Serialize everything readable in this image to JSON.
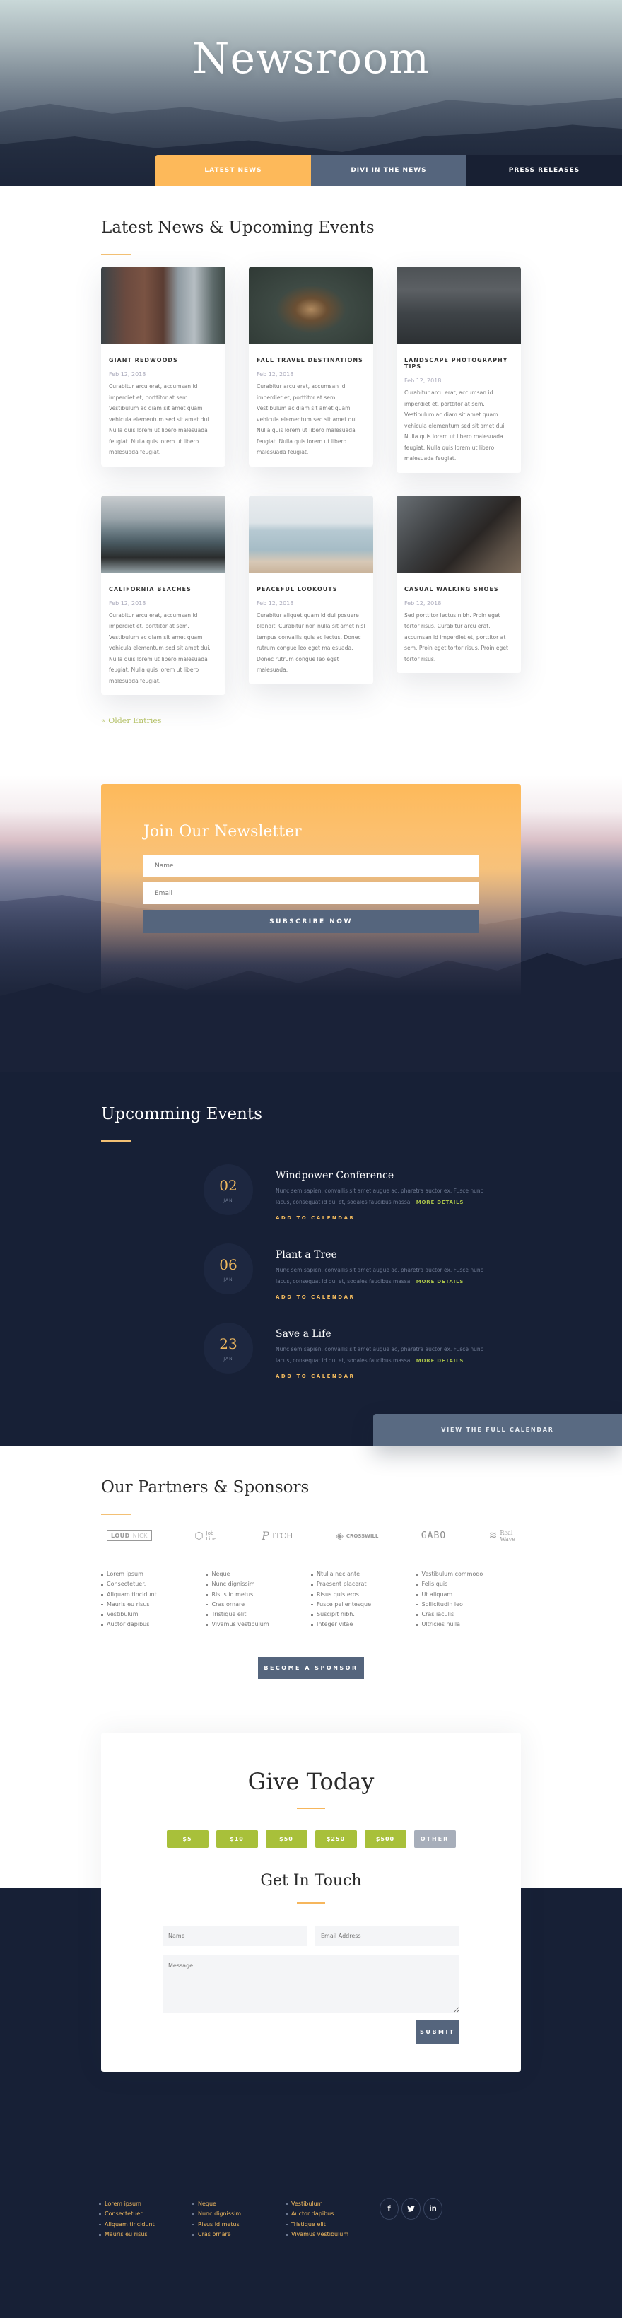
{
  "hero": {
    "title": "Newsroom",
    "tabs": [
      {
        "label": "LATEST NEWS",
        "active": true
      },
      {
        "label": "DIVI IN THE NEWS",
        "active": false
      },
      {
        "label": "PRESS RELEASES",
        "active": false
      }
    ]
  },
  "news": {
    "heading": "Latest News & Upcoming Events",
    "posts": [
      {
        "title": "GIANT REDWOODS",
        "date": "Feb 12, 2018",
        "excerpt": "Curabitur arcu erat, accumsan id imperdiet et, porttitor at sem. Vestibulum ac diam sit amet quam vehicula elementum sed sit amet dui. Nulla quis lorem ut libero malesuada feugiat. Nulla quis lorem ut libero malesuada feugiat."
      },
      {
        "title": "FALL TRAVEL DESTINATIONS",
        "date": "Feb 12, 2018",
        "excerpt": "Curabitur arcu erat, accumsan id imperdiet et, porttitor at sem. Vestibulum ac diam sit amet quam vehicula elementum sed sit amet dui. Nulla quis lorem ut libero malesuada feugiat. Nulla quis lorem ut libero malesuada feugiat."
      },
      {
        "title": "LANDSCAPE PHOTOGRAPHY TIPS",
        "date": "Feb 12, 2018",
        "excerpt": "Curabitur arcu erat, accumsan id imperdiet et, porttitor at sem. Vestibulum ac diam sit amet quam vehicula elementum sed sit amet dui. Nulla quis lorem ut libero malesuada feugiat. Nulla quis lorem ut libero malesuada feugiat."
      },
      {
        "title": "CALIFORNIA BEACHES",
        "date": "Feb 12, 2018",
        "excerpt": "Curabitur arcu erat, accumsan id imperdiet et, porttitor at sem. Vestibulum ac diam sit amet quam vehicula elementum sed sit amet dui. Nulla quis lorem ut libero malesuada feugiat. Nulla quis lorem ut libero malesuada feugiat."
      },
      {
        "title": "PEACEFUL LOOKOUTS",
        "date": "Feb 12, 2018",
        "excerpt": "Curabitur aliquet quam id dui posuere blandit. Curabitur non nulla sit amet nisl tempus convallis quis ac lectus. Donec rutrum congue leo eget malesuada. Donec rutrum congue leo eget malesuada."
      },
      {
        "title": "CASUAL WALKING SHOES",
        "date": "Feb 12, 2018",
        "excerpt": "Sed porttitor lectus nibh. Proin eget tortor risus. Curabitur arcu erat, accumsan id imperdiet et, porttitor at sem. Proin eget tortor risus. Proin eget tortor risus."
      }
    ],
    "older_entries": "« Older Entries"
  },
  "newsletter": {
    "heading": "Join Our Newsletter",
    "name_placeholder": "Name",
    "email_placeholder": "Email",
    "button": "SUBSCRIBE NOW"
  },
  "events": {
    "heading": "Upcomming Events",
    "items": [
      {
        "day": "02",
        "month": "JAN",
        "title": "Windpower Conference",
        "desc": "Nunc sem sapien, convallis sit amet augue ac, pharetra auctor ex. Fusce nunc lacus, consequat id dui et, sodales faucibus massa.",
        "more": "MORE DETAILS",
        "cal": "ADD TO CALENDAR"
      },
      {
        "day": "06",
        "month": "JAN",
        "title": "Plant a Tree",
        "desc": "Nunc sem sapien, convallis sit amet augue ac, pharetra auctor ex. Fusce nunc lacus, consequat id dui et, sodales faucibus massa.",
        "more": "MORE DETAILS",
        "cal": "ADD TO CALENDAR"
      },
      {
        "day": "23",
        "month": "JAN",
        "title": "Save a Life",
        "desc": "Nunc sem sapien, convallis sit amet augue ac, pharetra auctor ex. Fusce nunc lacus, consequat id dui et, sodales faucibus massa.",
        "more": "MORE DETAILS",
        "cal": "ADD TO CALENDAR"
      }
    ],
    "full_calendar": "VIEW THE FULL CALENDAR"
  },
  "partners": {
    "heading": "Our Partners & Sponsors",
    "logos": {
      "loud_a": "LOUD",
      "loud_b": "NICK",
      "jobline": "Job Line",
      "pitch": "ITCH",
      "pitch_glyph": "P",
      "crosswill": "CROSSWILL",
      "gabo": "GABO",
      "real_a": "Real",
      "real_b": "Wave"
    },
    "lists": [
      [
        "Lorem ipsum",
        "Consectetuer.",
        "Aliquam tincidunt",
        "Mauris eu risus",
        "Vestibulum",
        "Auctor dapibus"
      ],
      [
        "Neque",
        "Nunc dignissim",
        "Risus id metus",
        "Cras ornare",
        "Tristique elit",
        "Vivamus vestibulum"
      ],
      [
        "Ntulla nec ante",
        "Praesent placerat",
        "Risus quis eros",
        "Fusce pellentesque",
        "Suscipit nibh.",
        "Integer vitae"
      ],
      [
        "Vestibulum commodo",
        "Felis quis",
        "Ut aliquam",
        "Sollicitudin leo",
        "Cras iaculis",
        "Ultricies nulla"
      ]
    ],
    "button": "BECOME A SPONSOR"
  },
  "give": {
    "heading": "Give Today",
    "amounts": [
      "$5",
      "$10",
      "$50",
      "$250",
      "$500",
      "OTHER"
    ]
  },
  "contact": {
    "heading": "Get In Touch",
    "name_placeholder": "Name",
    "email_placeholder": "Email Address",
    "message_placeholder": "Message",
    "submit": "SUBMIT"
  },
  "footer": {
    "lists": [
      [
        "Lorem ipsum",
        "Consectetuer.",
        "Aliquam tincidunt",
        "Mauris eu risus"
      ],
      [
        "Neque",
        "Nunc dignissim",
        "Risus id metus",
        "Cras ornare"
      ],
      [
        "Vestibulum",
        "Auctor dapibus",
        "Tristique elit",
        "Vivamus vestibulum"
      ]
    ],
    "social": [
      {
        "icon": "facebook-icon",
        "glyph": "f"
      },
      {
        "icon": "twitter-icon",
        "glyph": "t"
      },
      {
        "icon": "linkedin-icon",
        "glyph": "in"
      }
    ]
  },
  "colors": {
    "accent_orange": "#fdb95a",
    "slate": "#55657d",
    "navy": "#172036",
    "green": "#a8c03a",
    "gold": "#f0b95e"
  }
}
